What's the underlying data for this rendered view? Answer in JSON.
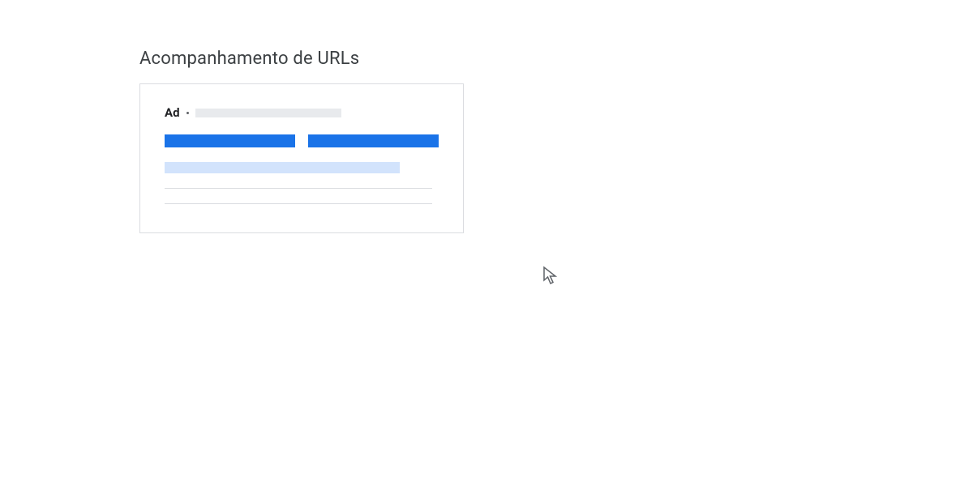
{
  "heading": "Acompanhamento de URLs",
  "ad": {
    "label": "Ad"
  }
}
